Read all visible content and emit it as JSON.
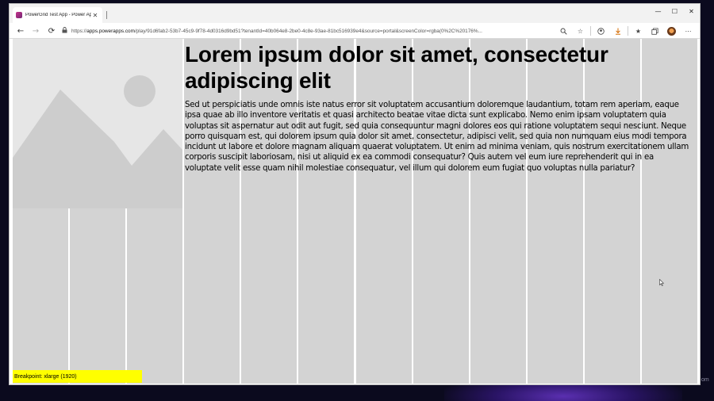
{
  "browser": {
    "tab_title": "PowerGrid Test App - Power Apps",
    "tab_close": "✕",
    "window_controls": {
      "minimize": "—",
      "maximize": "☐",
      "close": "✕"
    },
    "url_prefix": "https://",
    "url_host": "apps.powerapps.com",
    "url_path": "/play/91d6fab2-53b7-45c9-9f78-4d0316d9bd51?tenantId=40b064e8-2be0-4c8e-93ae-81bc516939e4&source=portal&screenColor=rgba(0%2C%20176%...",
    "nav_icons": {
      "back": "←",
      "forward": "→",
      "reload": "⟳"
    },
    "toolbar_icons": [
      "zoom-icon",
      "favorite-star-icon",
      "profile-icon",
      "download-icon",
      "favorites-bar-icon",
      "collections-icon",
      "account-avatar",
      "more-menu-icon"
    ]
  },
  "app": {
    "heading": "Lorem ipsum dolor sit amet, consectetur adipiscing elit",
    "body": "Sed ut perspiciatis unde omnis iste natus error sit voluptatem accusantium doloremque laudantium, totam rem aperiam, eaque ipsa quae ab illo inventore veritatis et quasi architecto beatae vitae dicta sunt explicabo. Nemo enim ipsam voluptatem quia voluptas sit aspernatur aut odit aut fugit, sed quia consequuntur magni dolores eos qui ratione voluptatem sequi nesciunt. Neque porro quisquam est, qui dolorem ipsum quia dolor sit amet, consectetur, adipisci velit, sed quia non numquam eius modi tempora incidunt ut labore et dolore magnam aliquam quaerat voluptatem. Ut enim ad minima veniam, quis nostrum exercitationem ullam corporis suscipit laboriosam, nisi ut aliquid ex ea commodi consequatur? Quis autem vel eum iure reprehenderit qui in ea voluptate velit esse quam nihil molestiae consequatur, vel illum qui dolorem eum fugiat quo voluptas nulla pariatur?",
    "breakpoint_label": "Breakpoint: xlarge (1920)",
    "grid_columns": 12,
    "image_placeholder_icon": "image-placeholder-icon"
  },
  "desktop": {
    "partial_text": "om"
  },
  "colors": {
    "grid_column": "#d3d3d3",
    "grid_gutter": "#ffffff",
    "breakpoint_badge": "#ffff00",
    "placeholder_bg": "#e6e6e6",
    "placeholder_shape": "#cdcdcd"
  }
}
